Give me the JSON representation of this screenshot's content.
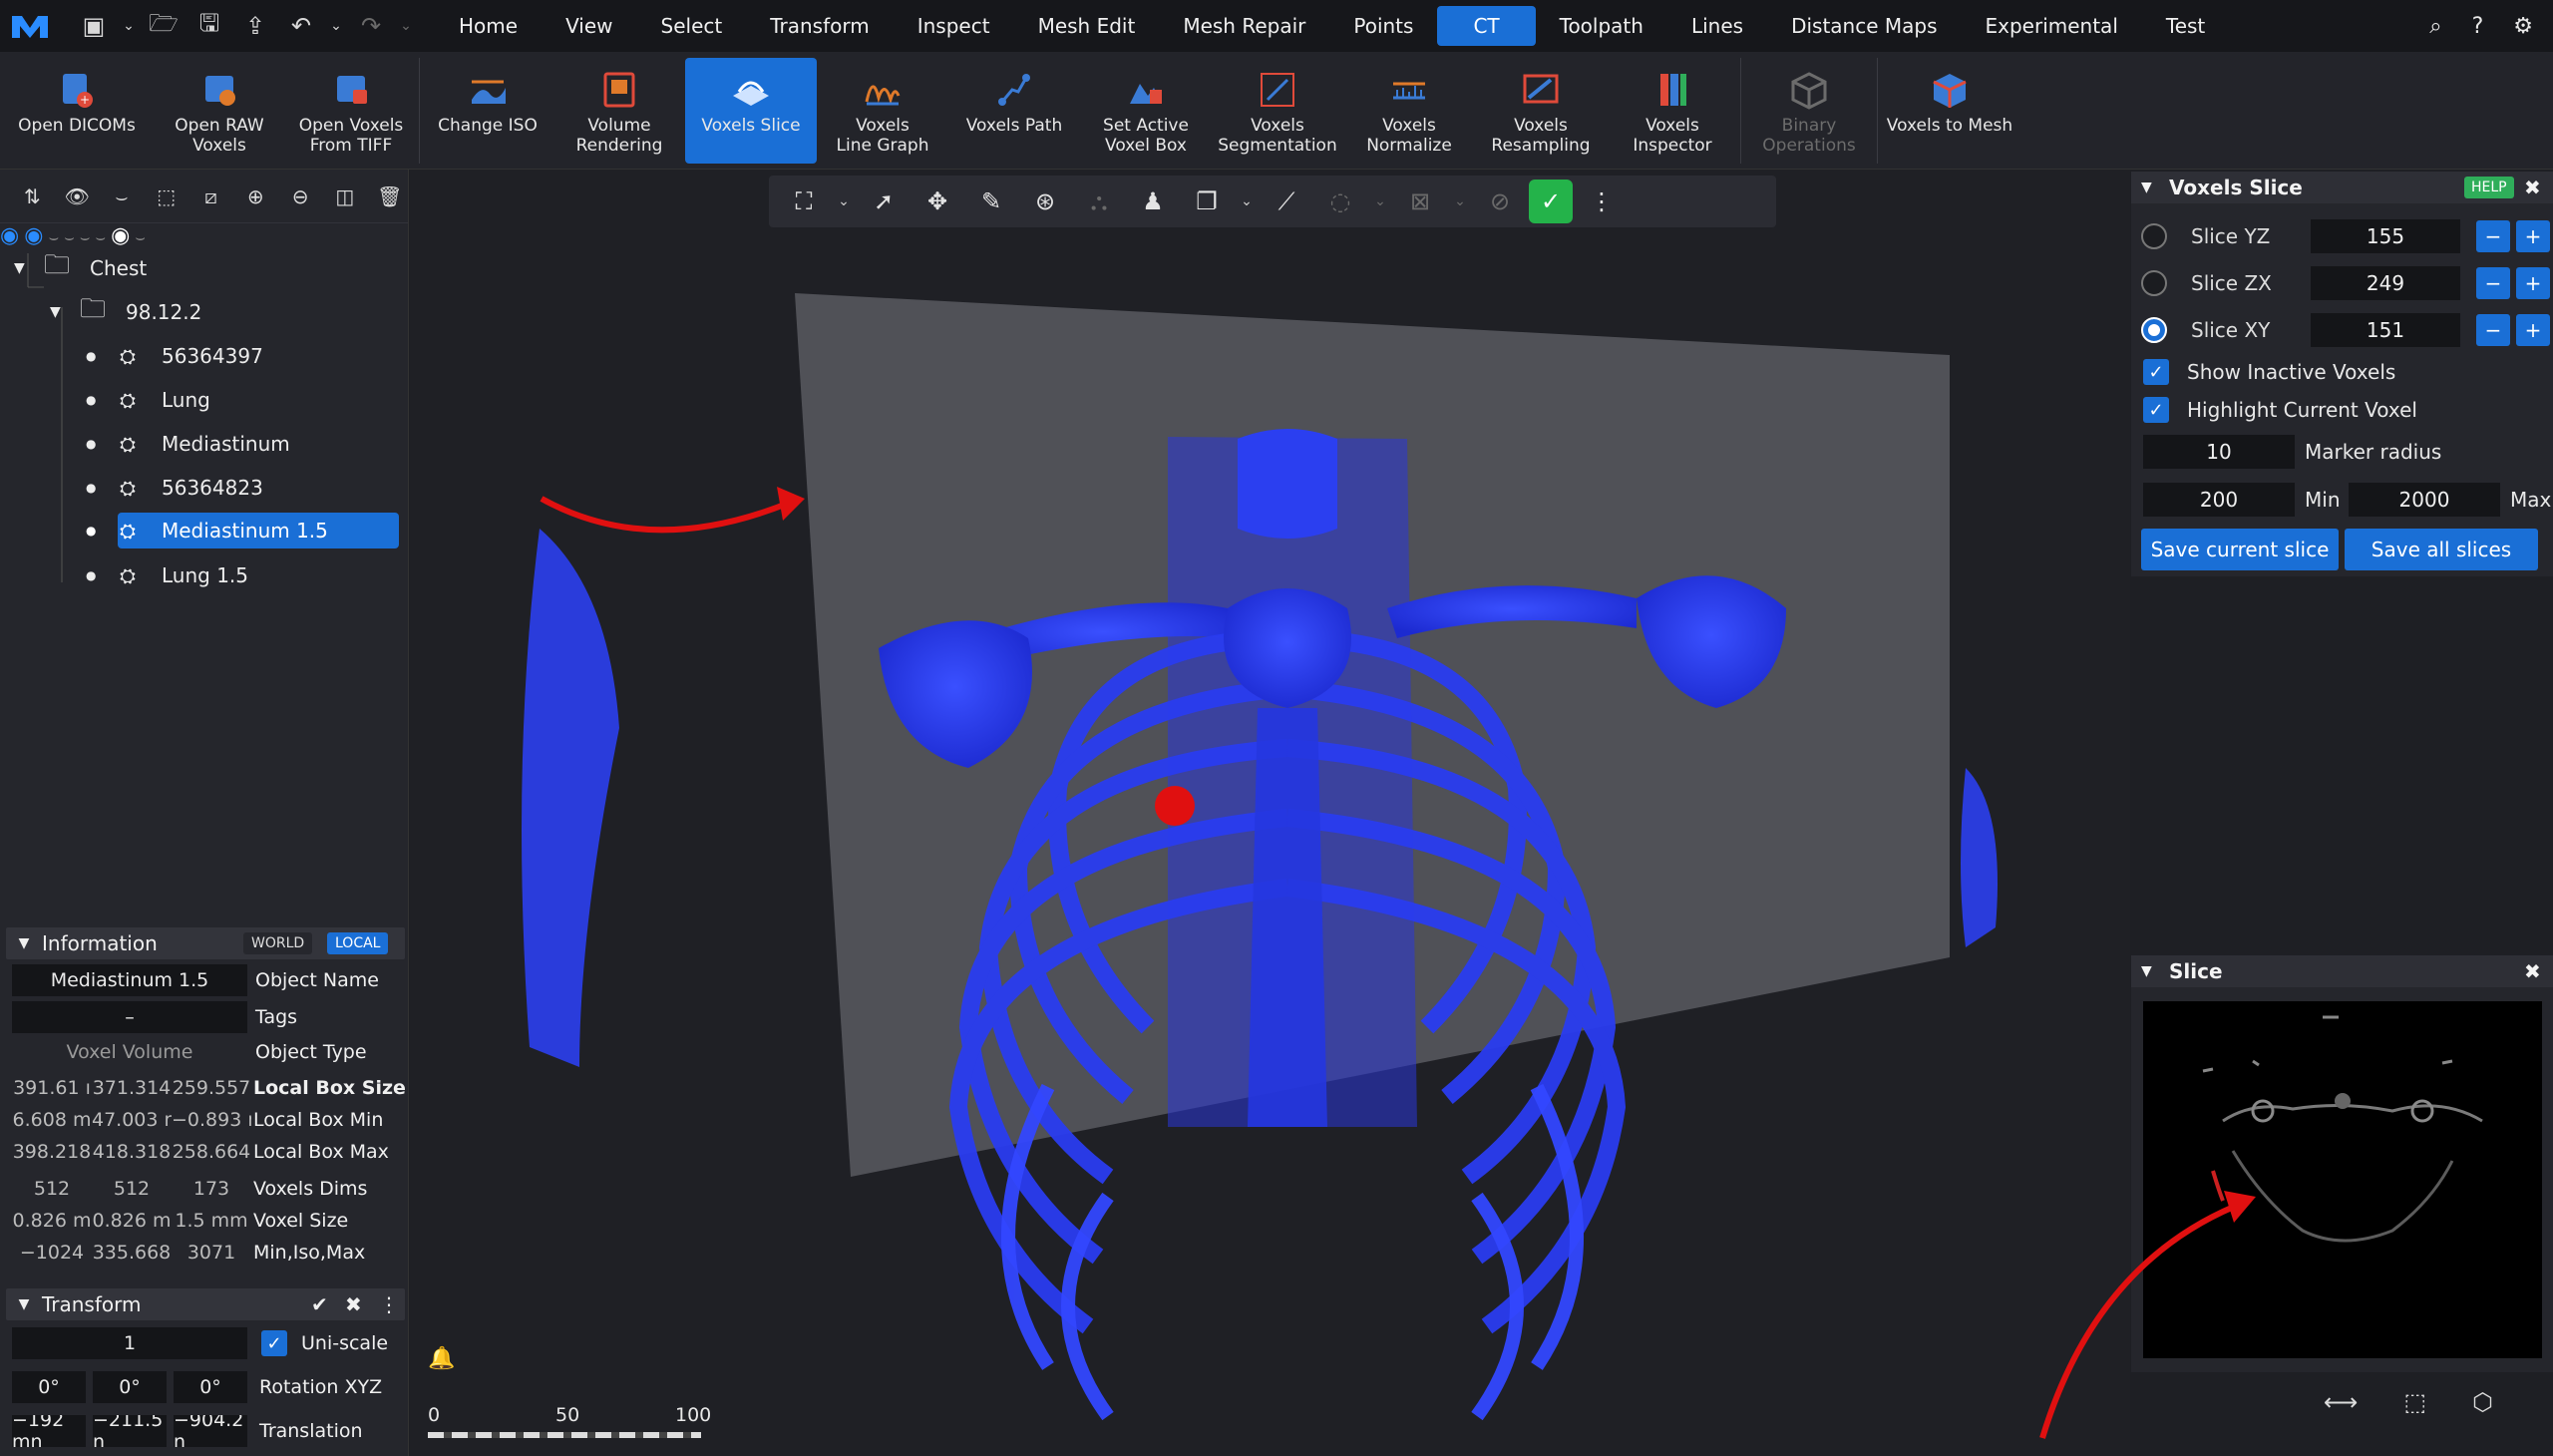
{
  "menu": {
    "tabs": [
      "Home",
      "View",
      "Select",
      "Transform",
      "Inspect",
      "Mesh Edit",
      "Mesh Repair",
      "Points",
      "CT",
      "Toolpath",
      "Lines",
      "Distance Maps",
      "Experimental",
      "Test"
    ],
    "active_tab": "CT"
  },
  "ribbon": {
    "buttons": [
      {
        "label": "Open DICOMs",
        "icon": "dicom-icon"
      },
      {
        "label": "Open RAW\nVoxels",
        "icon": "raw-voxels-icon"
      },
      {
        "label": "Open Voxels\nFrom TIFF",
        "icon": "tiff-icon"
      },
      {
        "label": "Change ISO",
        "icon": "iso-icon"
      },
      {
        "label": "Volume\nRendering",
        "icon": "volume-rendering-icon"
      },
      {
        "label": "Voxels Slice",
        "icon": "voxels-slice-icon"
      },
      {
        "label": "Voxels\nLine Graph",
        "icon": "line-graph-icon"
      },
      {
        "label": "Voxels Path",
        "icon": "voxels-path-icon"
      },
      {
        "label": "Set Active\nVoxel Box",
        "icon": "voxel-box-icon"
      },
      {
        "label": "Voxels\nSegmentation",
        "icon": "segmentation-icon"
      },
      {
        "label": "Voxels\nNormalize",
        "icon": "normalize-icon"
      },
      {
        "label": "Voxels\nResampling",
        "icon": "resampling-icon"
      },
      {
        "label": "Voxels\nInspector",
        "icon": "inspector-icon"
      },
      {
        "label": "Binary\nOperations",
        "icon": "binary-operations-icon"
      },
      {
        "label": "Voxels to Mesh",
        "icon": "voxels-to-mesh-icon"
      }
    ]
  },
  "tree": {
    "root": "Chest",
    "group": "98.12.2",
    "items": [
      "56364397",
      "Lung",
      "Mediastinum",
      "56364823",
      "Mediastinum 1.5",
      "Lung 1.5"
    ],
    "selected": "Mediastinum 1.5"
  },
  "information": {
    "title": "Information",
    "world_label": "WORLD",
    "local_label": "LOCAL",
    "object_name": "Mediastinum 1.5",
    "object_name_label": "Object Name",
    "tags": "–",
    "tags_label": "Tags",
    "object_type": "Voxel Volume",
    "object_type_label": "Object Type",
    "box_size": [
      "391.61 ı",
      "371.314",
      "259.557"
    ],
    "box_size_label": "Local Box Size",
    "box_min": [
      "6.608 m",
      "47.003 r",
      "−0.893 r"
    ],
    "box_min_label": "Local Box Min",
    "box_max": [
      "398.218",
      "418.318",
      "258.664"
    ],
    "box_max_label": "Local Box Max",
    "voxels_dims": [
      "512",
      "512",
      "173"
    ],
    "voxels_dims_label": "Voxels Dims",
    "voxel_size": [
      "0.826 m",
      "0.826 m",
      "1.5 mm"
    ],
    "voxel_size_label": "Voxel Size",
    "min_iso_max": [
      "−1024",
      "335.668",
      "3071"
    ],
    "min_iso_max_label": "Min,Iso,Max"
  },
  "transform": {
    "title": "Transform",
    "scale": "1",
    "uniscale_label": "Uni-scale",
    "rotation": [
      "0°",
      "0°",
      "0°"
    ],
    "rotation_label": "Rotation XYZ",
    "translation": [
      "−192 mn",
      "−211.5 n",
      "−904.2 n"
    ],
    "translation_label": "Translation"
  },
  "voxels_slice": {
    "title": "Voxels Slice",
    "help": "HELP",
    "slices": [
      {
        "label": "Slice YZ",
        "value": "155",
        "axis": "X",
        "selected": false
      },
      {
        "label": "Slice ZX",
        "value": "249",
        "axis": "Y",
        "selected": false
      },
      {
        "label": "Slice XY",
        "value": "151",
        "axis": "Z",
        "selected": true
      }
    ],
    "show_inactive": "Show Inactive Voxels",
    "highlight_current": "Highlight Current Voxel",
    "marker_radius": "10",
    "marker_radius_label": "Marker radius",
    "min_value": "200",
    "min_label": "Min",
    "max_value": "2000",
    "max_label": "Max",
    "save_current": "Save current slice",
    "save_all": "Save all slices"
  },
  "slice_panel": {
    "title": "Slice"
  },
  "scale_bar": {
    "ticks": [
      "0",
      "50",
      "100"
    ]
  },
  "colors": {
    "accent": "#1a6fd6",
    "mesh": "#2b3ff0",
    "marker": "#e01010"
  }
}
